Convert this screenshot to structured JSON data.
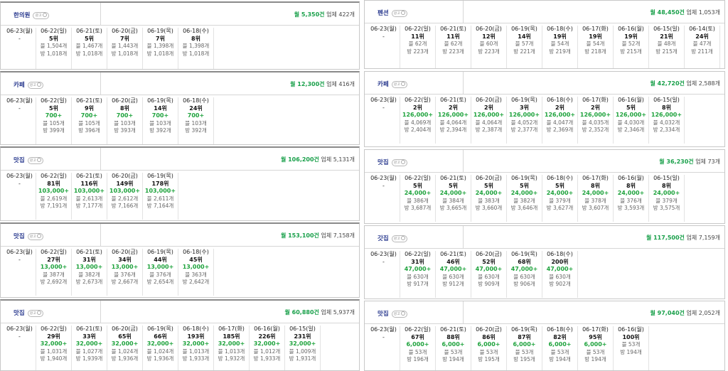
{
  "left": [
    {
      "name": "한의원",
      "badge": "광고",
      "monthly": "월 5,350건",
      "businesses": "업체 422개",
      "today": {
        "date": "06-23(월)",
        "dash": "-"
      },
      "days": [
        {
          "date": "06-22(일)",
          "rank": "5위",
          "post": "블 1,504개",
          "bang": "방 1,018개"
        },
        {
          "date": "06-21(토)",
          "rank": "5위",
          "post": "블 1,467개",
          "bang": "방 1,018개"
        },
        {
          "date": "06-20(금)",
          "rank": "7위",
          "post": "블 1,443개",
          "bang": "방 1,018개"
        },
        {
          "date": "06-19(목)",
          "rank": "7위",
          "post": "블 1,398개",
          "bang": "방 1,018개"
        },
        {
          "date": "06-18(수)",
          "rank": "8위",
          "post": "블 1,398개",
          "bang": "방 1,018개"
        }
      ]
    },
    {
      "name": "카페",
      "badge": "광고",
      "monthly": "월 12,300건",
      "businesses": "업체 416개",
      "today": {
        "date": "06-23(월)",
        "dash": "-"
      },
      "days": [
        {
          "date": "06-22(일)",
          "rank": "5위",
          "sales": "700+",
          "post": "블 105개",
          "bang": "방 399개"
        },
        {
          "date": "06-21(토)",
          "rank": "9위",
          "sales": "700+",
          "post": "블 105개",
          "bang": "방 396개"
        },
        {
          "date": "06-20(금)",
          "rank": "8위",
          "sales": "700+",
          "post": "블 103개",
          "bang": "방 393개"
        },
        {
          "date": "06-19(목)",
          "rank": "14위",
          "sales": "700+",
          "post": "블 103개",
          "bang": "방 392개"
        },
        {
          "date": "06-18(수)",
          "rank": "24위",
          "sales": "700+",
          "post": "블 103개",
          "bang": "방 392개"
        }
      ]
    },
    {
      "name": "맛집",
      "badge": "광고",
      "monthly": "월 106,200건",
      "businesses": "업체 5,131개",
      "today": {
        "date": "06-23(월)",
        "dash": "-"
      },
      "days": [
        {
          "date": "06-22(일)",
          "rank": "81위",
          "sales": "103,000+",
          "post": "블 2,619개",
          "bang": "방 7,191개"
        },
        {
          "date": "06-21(토)",
          "rank": "116위",
          "sales": "103,000+",
          "post": "블 2,613개",
          "bang": "방 7,177개"
        },
        {
          "date": "06-20(금)",
          "rank": "149위",
          "sales": "103,000+",
          "post": "블 2,612개",
          "bang": "방 7,166개"
        },
        {
          "date": "06-19(목)",
          "rank": "178위",
          "sales": "103,000+",
          "post": "블 2,611개",
          "bang": "방 7,164개"
        }
      ]
    },
    {
      "name": "맛집",
      "badge": "광고",
      "monthly": "월 153,100건",
      "businesses": "업체 7,158개",
      "today": {
        "date": "06-23(월)",
        "dash": "-"
      },
      "days": [
        {
          "date": "06-22(일)",
          "rank": "27위",
          "sales": "13,000+",
          "post": "블 387개",
          "bang": "방 2,692개"
        },
        {
          "date": "06-21(토)",
          "rank": "31위",
          "sales": "13,000+",
          "post": "블 382개",
          "bang": "방 2,673개"
        },
        {
          "date": "06-20(금)",
          "rank": "34위",
          "sales": "13,000+",
          "post": "블 376개",
          "bang": "방 2,667개"
        },
        {
          "date": "06-19(목)",
          "rank": "44위",
          "sales": "13,000+",
          "post": "블 376개",
          "bang": "방 2,654개"
        },
        {
          "date": "06-18(수)",
          "rank": "45위",
          "sales": "13,000+",
          "post": "블 363개",
          "bang": "방 2,642개"
        }
      ]
    },
    {
      "name": "맛집",
      "badge": "광고",
      "monthly": "월 60,880건",
      "businesses": "업체 5,937개",
      "today": {
        "date": "06-23(월)",
        "dash": "-"
      },
      "days": [
        {
          "date": "06-22(일)",
          "rank": "29위",
          "sales": "32,000+",
          "post": "블 1,031개",
          "bang": "방 1,940개"
        },
        {
          "date": "06-21(토)",
          "rank": "33위",
          "sales": "32,000+",
          "post": "블 1,027개",
          "bang": "방 1,939개"
        },
        {
          "date": "06-20(금)",
          "rank": "65위",
          "sales": "32,000+",
          "post": "블 1,024개",
          "bang": "방 1,936개"
        },
        {
          "date": "06-19(목)",
          "rank": "66위",
          "sales": "32,000+",
          "post": "블 1,024개",
          "bang": "방 1,936개"
        },
        {
          "date": "06-18(수)",
          "rank": "193위",
          "sales": "32,000+",
          "post": "블 1,013개",
          "bang": "방 1,933개"
        },
        {
          "date": "06-17(화)",
          "rank": "185위",
          "sales": "32,000+",
          "post": "블 1,013개",
          "bang": "방 1,932개"
        },
        {
          "date": "06-16(월)",
          "rank": "226위",
          "sales": "32,000+",
          "post": "블 1,012개",
          "bang": "방 1,933개"
        },
        {
          "date": "06-15(일)",
          "rank": "231위",
          "sales": "32,000+",
          "post": "블 1,009개",
          "bang": "방 1,931개"
        }
      ]
    }
  ],
  "right": [
    {
      "name": "펜션",
      "badge": "광고",
      "monthly": "월 48,450건",
      "businesses": "업체 1,053개",
      "today": {
        "date": "06-23(월)",
        "dash": "-"
      },
      "days": [
        {
          "date": "06-22(일)",
          "rank": "11위",
          "post": "블 62개",
          "bang": "방 223개"
        },
        {
          "date": "06-21(토)",
          "rank": "11위",
          "post": "블 62개",
          "bang": "방 223개"
        },
        {
          "date": "06-20(금)",
          "rank": "12위",
          "post": "블 60개",
          "bang": "방 223개"
        },
        {
          "date": "06-19(목)",
          "rank": "14위",
          "post": "블 57개",
          "bang": "방 221개"
        },
        {
          "date": "06-18(수)",
          "rank": "19위",
          "post": "블 54개",
          "bang": "방 219개"
        },
        {
          "date": "06-17(화)",
          "rank": "19위",
          "post": "블 54개",
          "bang": "방 218개"
        },
        {
          "date": "06-16(월)",
          "rank": "19위",
          "post": "블 52개",
          "bang": "방 215개"
        },
        {
          "date": "06-15(일)",
          "rank": "21위",
          "post": "블 48개",
          "bang": "방 215개"
        },
        {
          "date": "06-14(토)",
          "rank": "24위",
          "post": "블 47개",
          "bang": "방 211개"
        }
      ]
    },
    {
      "name": "카페",
      "badge": "광고",
      "monthly": "월 42,720건",
      "businesses": "업체 2,588개",
      "today": {
        "date": "06-23(월)",
        "dash": "-"
      },
      "days": [
        {
          "date": "06-22(일)",
          "rank": "2위",
          "sales": "126,000+",
          "post": "블 4,069개",
          "bang": "방 2,404개"
        },
        {
          "date": "06-21(토)",
          "rank": "2위",
          "sales": "126,000+",
          "post": "블 4,064개",
          "bang": "방 2,394개"
        },
        {
          "date": "06-20(금)",
          "rank": "2위",
          "sales": "126,000+",
          "post": "블 4,064개",
          "bang": "방 2,387개"
        },
        {
          "date": "06-19(목)",
          "rank": "3위",
          "sales": "126,000+",
          "post": "블 4,052개",
          "bang": "방 2,377개"
        },
        {
          "date": "06-18(수)",
          "rank": "2위",
          "sales": "126,000+",
          "post": "블 4,047개",
          "bang": "방 2,369개"
        },
        {
          "date": "06-17(화)",
          "rank": "2위",
          "sales": "126,000+",
          "post": "블 4,035개",
          "bang": "방 2,352개"
        },
        {
          "date": "06-16(월)",
          "rank": "5위",
          "sales": "126,000+",
          "post": "블 4,030개",
          "bang": "방 2,346개"
        },
        {
          "date": "06-15(일)",
          "rank": "8위",
          "sales": "126,000+",
          "post": "블 4,032개",
          "bang": "방 2,334개"
        }
      ]
    },
    {
      "name": "맛집",
      "badge": "광고",
      "monthly": "월 36,230건",
      "businesses": "업체 73개",
      "today": {
        "date": "06-23(월)",
        "dash": "-"
      },
      "days": [
        {
          "date": "06-22(일)",
          "rank": "5위",
          "sales": "24,000+",
          "post": "블 386개",
          "bang": "방 3,687개"
        },
        {
          "date": "06-21(토)",
          "rank": "5위",
          "sales": "24,000+",
          "post": "블 384개",
          "bang": "방 3,665개"
        },
        {
          "date": "06-20(금)",
          "rank": "5위",
          "sales": "24,000+",
          "post": "블 383개",
          "bang": "방 3,660개"
        },
        {
          "date": "06-19(목)",
          "rank": "5위",
          "sales": "24,000+",
          "post": "블 382개",
          "bang": "방 3,646개"
        },
        {
          "date": "06-18(수)",
          "rank": "5위",
          "sales": "24,000+",
          "post": "블 379개",
          "bang": "방 3,627개"
        },
        {
          "date": "06-17(화)",
          "rank": "8위",
          "sales": "24,000+",
          "post": "블 378개",
          "bang": "방 3,607개"
        },
        {
          "date": "06-16(월)",
          "rank": "8위",
          "sales": "24,000+",
          "post": "블 376개",
          "bang": "방 3,593개"
        },
        {
          "date": "06-15(일)",
          "rank": "8위",
          "sales": "24,000+",
          "post": "블 379개",
          "bang": "방 3,575개"
        }
      ]
    },
    {
      "name": "갓집",
      "badge": "광고",
      "monthly": "월 117,500건",
      "businesses": "업체 7,159개",
      "today": {
        "date": "06-23(월)",
        "dash": "-"
      },
      "days": [
        {
          "date": "06-22(일)",
          "rank": "31위",
          "sales": "47,000+",
          "post": "블 630개",
          "bang": "방 917개"
        },
        {
          "date": "06-21(토)",
          "rank": "46위",
          "sales": "47,000+",
          "post": "블 630개",
          "bang": "방 912개"
        },
        {
          "date": "06-20(금)",
          "rank": "52위",
          "sales": "47,000+",
          "post": "블 630개",
          "bang": "방 909개"
        },
        {
          "date": "06-19(목)",
          "rank": "68위",
          "sales": "47,000+",
          "post": "블 630개",
          "bang": "방 906개"
        },
        {
          "date": "06-18(수)",
          "rank": "200위",
          "sales": "47,000+",
          "post": "블 630개",
          "bang": "방 902개"
        }
      ]
    },
    {
      "name": "맛집",
      "badge": "광고",
      "monthly": "월 97,040건",
      "businesses": "업체 2,052개",
      "today": {
        "date": "06-23(월)",
        "dash": "-"
      },
      "days": [
        {
          "date": "06-22(일)",
          "rank": "67위",
          "sales": "6,000+",
          "post": "블 53개",
          "bang": "방 196개"
        },
        {
          "date": "06-21(토)",
          "rank": "88위",
          "sales": "6,000+",
          "post": "블 53개",
          "bang": "방 194개"
        },
        {
          "date": "06-20(금)",
          "rank": "86위",
          "sales": "6,000+",
          "post": "블 53개",
          "bang": "방 195개"
        },
        {
          "date": "06-19(목)",
          "rank": "87위",
          "sales": "6,000+",
          "post": "블 53개",
          "bang": "방 195개"
        },
        {
          "date": "06-18(수)",
          "rank": "82위",
          "sales": "6,000+",
          "post": "블 53개",
          "bang": "방 194개"
        },
        {
          "date": "06-17(화)",
          "rank": "95위",
          "sales": "6,000+",
          "post": "블 53개",
          "bang": "방 194개"
        },
        {
          "date": "06-16(월)",
          "rank": "100위",
          "post": "블 53개",
          "bang": "방 194개"
        }
      ]
    }
  ]
}
